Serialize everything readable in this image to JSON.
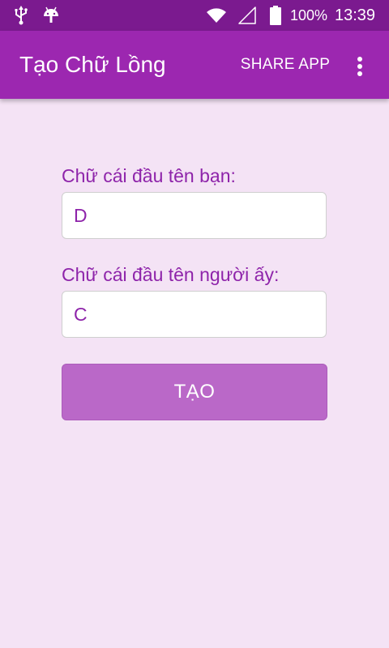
{
  "status_bar": {
    "left_icons": [
      "usb-icon",
      "android-icon"
    ],
    "right_icons": [
      "wifi-icon",
      "signal-icon",
      "battery-icon"
    ],
    "battery": "100%",
    "time": "13:39",
    "colors": {
      "background": "#7b1a8f",
      "foreground": "#ffffff"
    }
  },
  "app_bar": {
    "title": "Tạo Chữ Lồng",
    "share_label": "SHARE APP",
    "overflow_icon": "more-vert-icon",
    "colors": {
      "background": "#9c27b0",
      "foreground": "#ffffff"
    }
  },
  "form": {
    "your_initial_label": "Chữ cái đầu tên bạn:",
    "your_initial_value": "D",
    "their_initial_label": "Chữ cái đầu tên người ấy:",
    "their_initial_value": "C",
    "submit_label": "TẠO",
    "colors": {
      "label": "#8e24aa",
      "button": "#ba68c8",
      "page_background": "#f4e3f5"
    }
  }
}
